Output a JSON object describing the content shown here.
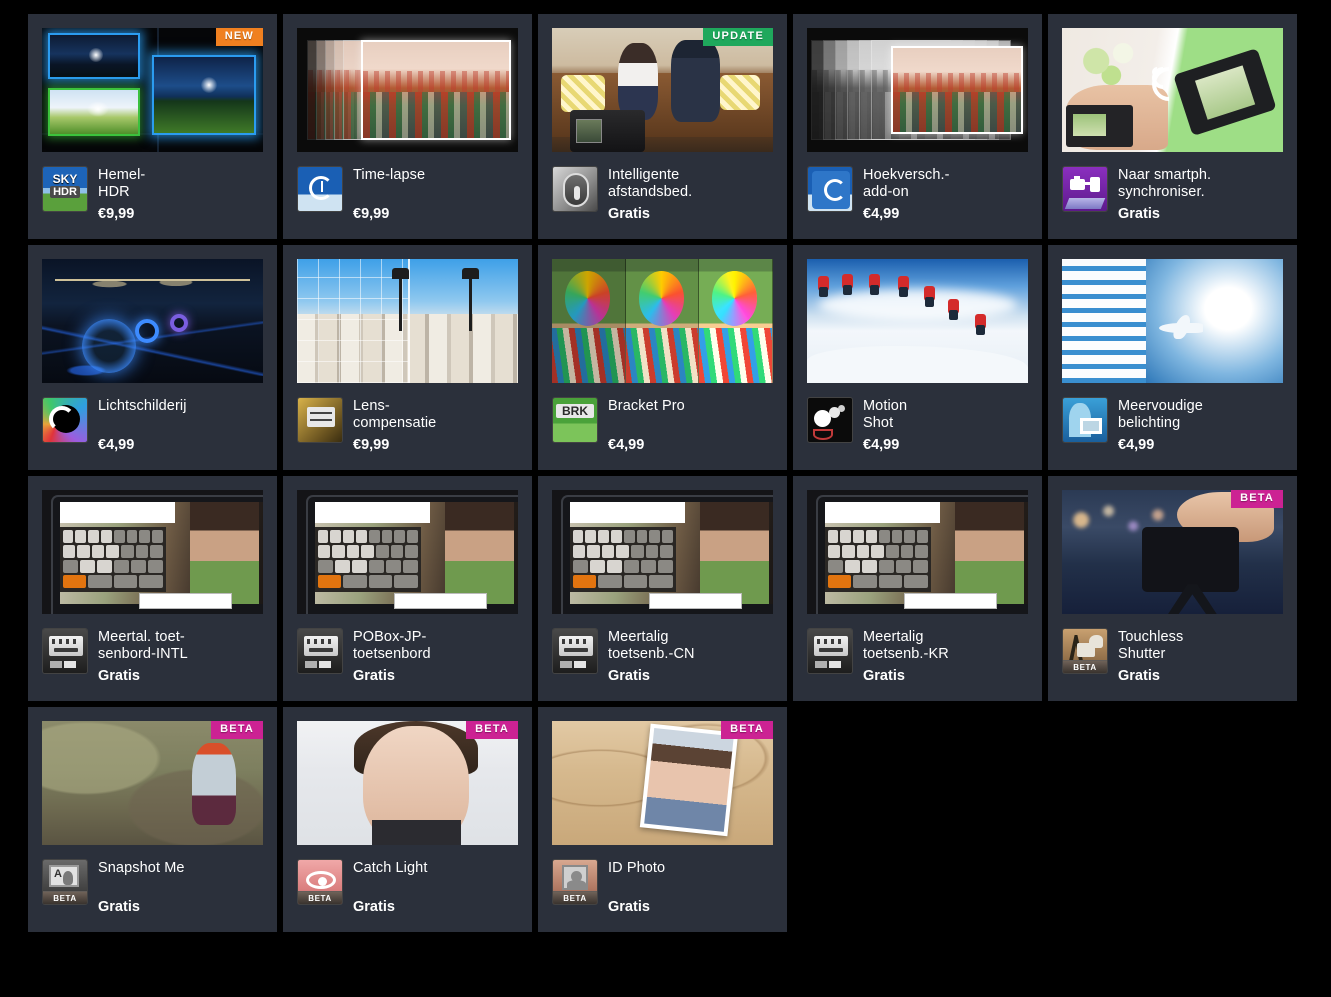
{
  "page": {
    "background_color": "#000000",
    "card_color": "#2b303b",
    "columns": 5,
    "badge_colors": {
      "new": "#f08020",
      "update": "#1fa85c",
      "beta": "#cc2293"
    },
    "badge_labels": {
      "new": "NEW",
      "update": "UPDATE",
      "beta": "BETA",
      "icon_beta": "BETA"
    }
  },
  "apps": [
    {
      "title": "Hemel-\nHDR",
      "price": "€9,99",
      "badge": "NEW",
      "badge_type": "new",
      "icon": "sky-hdr-icon",
      "art": "sky-hdr-art",
      "icon_beta": false
    },
    {
      "title": "Time-lapse",
      "price": "€9,99",
      "badge": null,
      "badge_type": null,
      "icon": "time-lapse-icon",
      "art": "time-lapse-art",
      "icon_beta": false
    },
    {
      "title": "Intelligente\nafstandsbed.",
      "price": "Gratis",
      "badge": "UPDATE",
      "badge_type": "update",
      "icon": "smart-remote-icon",
      "art": "smart-remote-art",
      "icon_beta": false
    },
    {
      "title": "Hoekversch.-\nadd-on",
      "price": "€4,99",
      "badge": null,
      "badge_type": null,
      "icon": "angle-shift-addon-icon",
      "art": "angle-shift-art",
      "icon_beta": false
    },
    {
      "title": "Naar smartph.\nsynchroniser.",
      "price": "Gratis",
      "badge": null,
      "badge_type": null,
      "icon": "sync-to-smartphone-icon",
      "art": "sync-smartphone-art",
      "icon_beta": false
    },
    {
      "title": "Lichtschilderij",
      "price": "€4,99",
      "badge": null,
      "badge_type": null,
      "icon": "light-painting-icon",
      "art": "light-painting-art",
      "icon_beta": false
    },
    {
      "title": "Lens-\ncompensatie",
      "price": "€9,99",
      "badge": null,
      "badge_type": null,
      "icon": "lens-compensation-icon",
      "art": "lens-compensation-art",
      "icon_beta": false
    },
    {
      "title": "Bracket Pro",
      "price": "€4,99",
      "badge": null,
      "badge_type": null,
      "icon": "bracket-pro-icon",
      "art": "bracket-pro-art",
      "icon_beta": false
    },
    {
      "title": "Motion\nShot",
      "price": "€4,99",
      "badge": null,
      "badge_type": null,
      "icon": "motion-shot-icon",
      "art": "motion-shot-art",
      "icon_beta": false
    },
    {
      "title": "Meervoudige\nbelichting",
      "price": "€4,99",
      "badge": null,
      "badge_type": null,
      "icon": "multiple-exposure-icon",
      "art": "multiple-exposure-art",
      "icon_beta": false
    },
    {
      "title": "Meertal. toet-\nsenbord-INTL",
      "price": "Gratis",
      "badge": null,
      "badge_type": null,
      "icon": "keyboard-icon",
      "art": "keyboard-intl-art",
      "icon_beta": false
    },
    {
      "title": "POBox-JP-\ntoetsenbord",
      "price": "Gratis",
      "badge": null,
      "badge_type": null,
      "icon": "keyboard-icon",
      "art": "keyboard-jp-art",
      "icon_beta": false
    },
    {
      "title": "Meertalig\ntoetsenb.-CN",
      "price": "Gratis",
      "badge": null,
      "badge_type": null,
      "icon": "keyboard-icon",
      "art": "keyboard-cn-art",
      "icon_beta": false
    },
    {
      "title": "Meertalig\ntoetsenb.-KR",
      "price": "Gratis",
      "badge": null,
      "badge_type": null,
      "icon": "keyboard-icon",
      "art": "keyboard-kr-art",
      "icon_beta": false
    },
    {
      "title": "Touchless\nShutter",
      "price": "Gratis",
      "badge": "BETA",
      "badge_type": "beta",
      "icon": "touchless-shutter-icon",
      "art": "touchless-shutter-art",
      "icon_beta": true
    },
    {
      "title": "Snapshot Me",
      "price": "Gratis",
      "badge": "BETA",
      "badge_type": "beta",
      "icon": "snapshot-me-icon",
      "art": "snapshot-me-art",
      "icon_beta": true
    },
    {
      "title": "Catch Light",
      "price": "Gratis",
      "badge": "BETA",
      "badge_type": "beta",
      "icon": "catch-light-icon",
      "art": "catch-light-art",
      "icon_beta": true
    },
    {
      "title": "ID Photo",
      "price": "Gratis",
      "badge": "BETA",
      "badge_type": "beta",
      "icon": "id-photo-icon",
      "art": "id-photo-art",
      "icon_beta": true
    }
  ]
}
